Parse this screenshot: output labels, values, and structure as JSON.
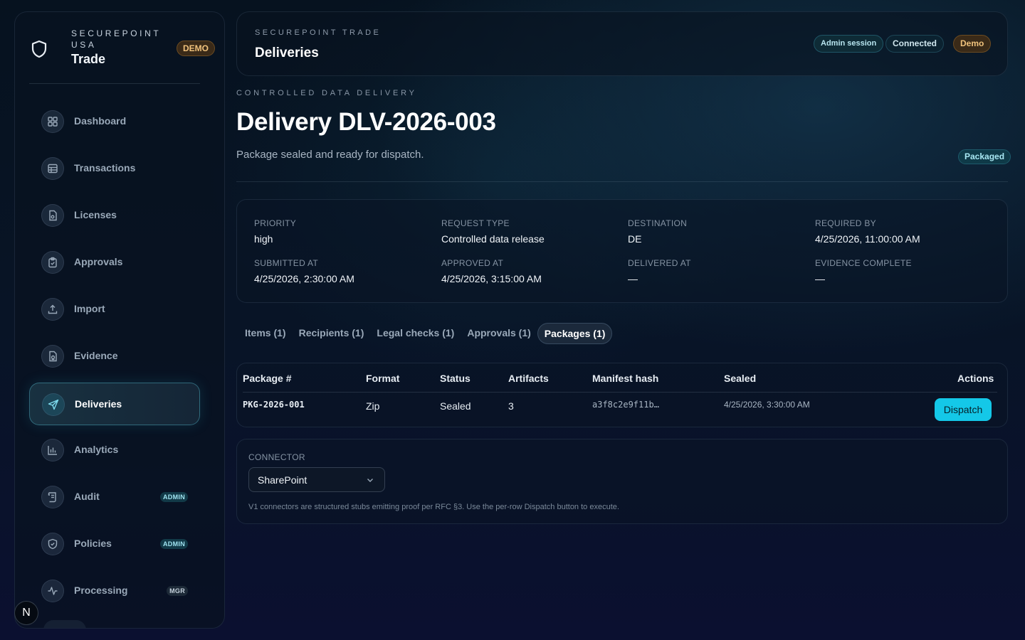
{
  "brand": {
    "eyebrow": "SECUREPOINT USA",
    "name": "Trade",
    "badge": "DEMO"
  },
  "sidebar": {
    "items": [
      {
        "key": "dashboard",
        "label": "Dashboard",
        "icon": "grid-icon",
        "badge": ""
      },
      {
        "key": "transactions",
        "label": "Transactions",
        "icon": "table-icon",
        "badge": ""
      },
      {
        "key": "licenses",
        "label": "Licenses",
        "icon": "license-file-icon",
        "badge": ""
      },
      {
        "key": "approvals",
        "label": "Approvals",
        "icon": "clipboard-check-icon",
        "badge": ""
      },
      {
        "key": "import",
        "label": "Import",
        "icon": "upload-icon",
        "badge": ""
      },
      {
        "key": "evidence",
        "label": "Evidence",
        "icon": "evidence-file-icon",
        "badge": ""
      },
      {
        "key": "deliveries",
        "label": "Deliveries",
        "icon": "send-icon",
        "badge": "",
        "active": true
      },
      {
        "key": "analytics",
        "label": "Analytics",
        "icon": "bar-chart-icon",
        "badge": ""
      },
      {
        "key": "audit",
        "label": "Audit",
        "icon": "scroll-icon",
        "badge": "ADMIN"
      },
      {
        "key": "policies",
        "label": "Policies",
        "icon": "shield-check-icon",
        "badge": "ADMIN"
      },
      {
        "key": "processing",
        "label": "Processing",
        "icon": "activity-icon",
        "badge": "MGR"
      }
    ],
    "footer_button": "N"
  },
  "header": {
    "eyebrow": "SECUREPOINT TRADE",
    "title": "Deliveries",
    "pills": {
      "session": "Admin session",
      "connection": "Connected",
      "mode": "Demo"
    }
  },
  "page": {
    "eyebrow": "CONTROLLED DATA DELIVERY",
    "title": "Delivery DLV-2026-003",
    "subtitle": "Package sealed and ready for dispatch.",
    "status": "Packaged"
  },
  "meta": {
    "priority": {
      "label": "PRIORITY",
      "value": "high"
    },
    "request_type": {
      "label": "REQUEST TYPE",
      "value": "Controlled data release"
    },
    "destination": {
      "label": "DESTINATION",
      "value": "DE"
    },
    "required_by": {
      "label": "REQUIRED BY",
      "value": "4/25/2026, 11:00:00 AM"
    },
    "submitted_at": {
      "label": "SUBMITTED AT",
      "value": "4/25/2026, 2:30:00 AM"
    },
    "approved_at": {
      "label": "APPROVED AT",
      "value": "4/25/2026, 3:15:00 AM"
    },
    "delivered_at": {
      "label": "DELIVERED AT",
      "value": "—"
    },
    "evidence_complete": {
      "label": "EVIDENCE COMPLETE",
      "value": "—"
    }
  },
  "tabs": [
    {
      "label": "Items (1)"
    },
    {
      "label": "Recipients (1)"
    },
    {
      "label": "Legal checks (1)"
    },
    {
      "label": "Approvals (1)"
    },
    {
      "label": "Packages (1)",
      "active": true
    }
  ],
  "packages_table": {
    "columns": {
      "package": "Package #",
      "format": "Format",
      "status": "Status",
      "artifacts": "Artifacts",
      "manifest_hash": "Manifest hash",
      "sealed": "Sealed",
      "actions": "Actions"
    },
    "rows": [
      {
        "package": "PKG-2026-001",
        "format": "Zip",
        "status": "Sealed",
        "artifacts": "3",
        "manifest_hash": "a3f8c2e9f11b…",
        "sealed": "4/25/2026, 3:30:00 AM",
        "action_label": "Dispatch"
      }
    ]
  },
  "connector": {
    "label": "CONNECTOR",
    "selected": "SharePoint",
    "help": "V1 connectors are structured stubs emitting proof per RFC §3. Use the per-row Dispatch button to execute."
  },
  "colors": {
    "accent": "#14c8e8",
    "demo_badge": "#f0c27c",
    "background": "#07131f"
  }
}
